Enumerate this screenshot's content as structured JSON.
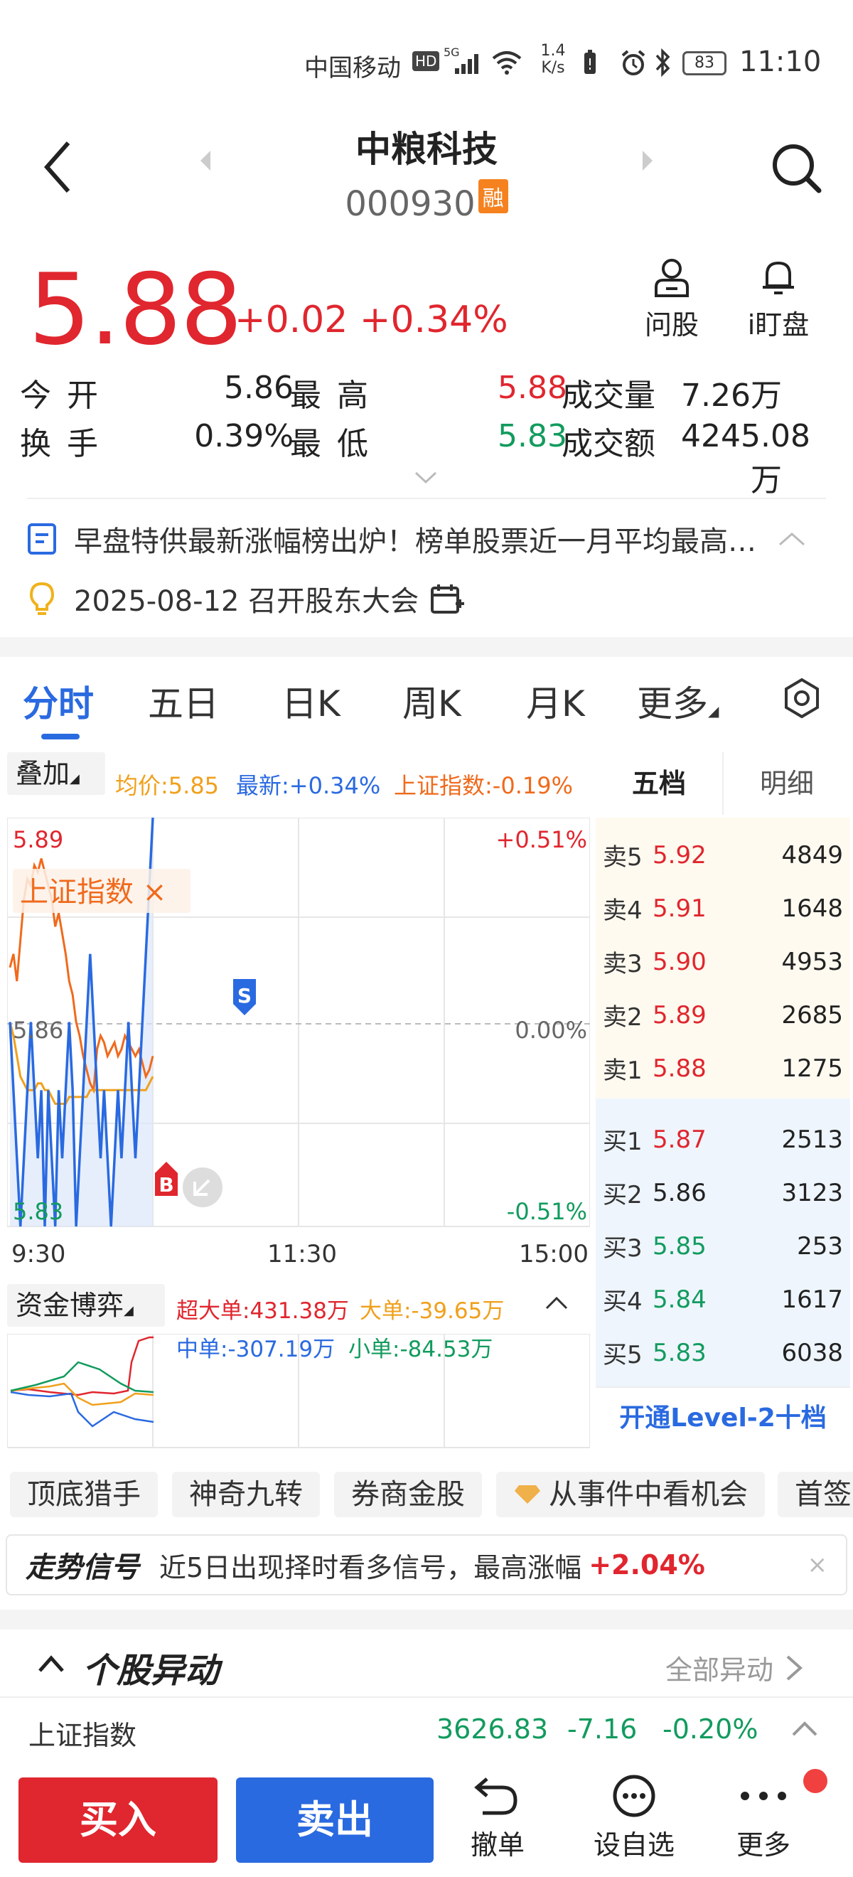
{
  "status_bar": {
    "carrier": "中国移动",
    "hd": "HD",
    "signal": "5G",
    "net_speed_value": "1.4",
    "net_speed_unit": "K/s",
    "battery": "83",
    "time": "11:10"
  },
  "header": {
    "title": "中粮科技",
    "code": "000930",
    "badge": "融"
  },
  "price": {
    "last": "5.88",
    "change": "+0.02",
    "change_pct": "+0.34%"
  },
  "actions": {
    "ask": "问股",
    "watch": "i盯盘"
  },
  "quote": {
    "open_label": "今开",
    "open": "5.86",
    "high_label": "最高",
    "high": "5.88",
    "vol_label": "成交量",
    "vol": "7.26万",
    "turn_label": "换手",
    "turn": "0.39%",
    "low_label": "最低",
    "low": "5.83",
    "amt_label": "成交额",
    "amt": "4245.08万"
  },
  "news": {
    "headline": "早盘特供最新涨幅榜出炉！榜单股票近一月平均最高…",
    "event": "2025-08-12 召开股东大会"
  },
  "tabs": [
    "分时",
    "五日",
    "日K",
    "周K",
    "月K",
    "更多"
  ],
  "overlay": {
    "label": "叠加",
    "avg": "均价:5.85",
    "latest": "最新:+0.34%",
    "index": "上证指数:-0.19%",
    "tag": "上证指数 ×"
  },
  "chart_labels": {
    "ymax": "5.89",
    "ymid": "5.86",
    "ymin": "5.83",
    "pmax": "+0.51%",
    "pmid": "0.00%",
    "pmin": "-0.51%",
    "t0": "9:30",
    "t1": "11:30",
    "t2": "15:00",
    "s": "S",
    "b": "B"
  },
  "chart_data": {
    "type": "line",
    "ylim": [
      5.83,
      5.89
    ],
    "x_ticks": [
      "9:30",
      "11:30",
      "15:00"
    ],
    "series": [
      {
        "values": [
          5.86,
          5.85,
          5.84,
          5.83,
          5.84,
          5.85,
          5.86,
          5.85,
          5.84,
          5.85,
          5.83,
          5.85,
          5.84,
          5.83,
          5.85,
          5.84,
          5.85,
          5.86,
          5.85,
          5.83,
          5.84,
          5.85,
          5.86,
          5.87,
          5.86,
          5.85,
          5.84,
          5.85,
          5.84,
          5.83,
          5.84,
          5.85,
          5.84,
          5.85,
          5.86,
          5.85,
          5.84,
          5.85,
          5.86,
          5.87,
          5.88,
          5.89
        ]
      },
      {
        "values": [
          5.86,
          5.858,
          5.855,
          5.852,
          5.851,
          5.85,
          5.85,
          5.85,
          5.851,
          5.851,
          5.85,
          5.85,
          5.849,
          5.848,
          5.848,
          5.848,
          5.848,
          5.849,
          5.849,
          5.849,
          5.849,
          5.849,
          5.849,
          5.85,
          5.85,
          5.85,
          5.85,
          5.85,
          5.85,
          5.85,
          5.85,
          5.85,
          5.85,
          5.85,
          5.85,
          5.85,
          5.85,
          5.85,
          5.85,
          5.85,
          5.851,
          5.852
        ]
      },
      {
        "name": "上证指数",
        "values": [
          5.868,
          5.87,
          5.866,
          5.872,
          5.878,
          5.881,
          5.88,
          5.883,
          5.882,
          5.884,
          5.882,
          5.88,
          5.878,
          5.874,
          5.876,
          5.873,
          5.87,
          5.866,
          5.864,
          5.86,
          5.858,
          5.855,
          5.853,
          5.851,
          5.85,
          5.856,
          5.858,
          5.857,
          5.855,
          5.856,
          5.857,
          5.855,
          5.856,
          5.858,
          5.857,
          5.856,
          5.855,
          5.856,
          5.854,
          5.852,
          5.853,
          5.855
        ]
      }
    ]
  },
  "orderbook": {
    "tabs": [
      "五档",
      "明细"
    ],
    "asks": [
      {
        "label": "卖5",
        "price": "5.92",
        "vol": "4849"
      },
      {
        "label": "卖4",
        "price": "5.91",
        "vol": "1648"
      },
      {
        "label": "卖3",
        "price": "5.90",
        "vol": "4953"
      },
      {
        "label": "卖2",
        "price": "5.89",
        "vol": "2685"
      },
      {
        "label": "卖1",
        "price": "5.88",
        "vol": "1275"
      }
    ],
    "bids": [
      {
        "label": "买1",
        "price": "5.87",
        "vol": "2513"
      },
      {
        "label": "买2",
        "price": "5.86",
        "vol": "3123"
      },
      {
        "label": "买3",
        "price": "5.85",
        "vol": "253"
      },
      {
        "label": "买4",
        "price": "5.84",
        "vol": "1617"
      },
      {
        "label": "买5",
        "price": "5.83",
        "vol": "6038"
      }
    ],
    "level2": "开通Level-2十档"
  },
  "fund": {
    "label": "资金博弈",
    "super": "超大单:431.38万",
    "big": "大单:-39.65万",
    "mid": "中单:-307.19万",
    "small": "小单:-84.53万"
  },
  "chips": [
    "顶底猎手",
    "神奇九转",
    "券商金股",
    "从事件中看机会",
    "首签"
  ],
  "signal": {
    "title": "走势信号",
    "text": "近5日出现择时看多信号，最高涨幅",
    "value": "+2.04%"
  },
  "movement": {
    "title": "个股异动",
    "all": "全部异动"
  },
  "index_bar": {
    "name": "上证指数",
    "value": "3626.83",
    "change": "-7.16",
    "pct": "-0.20%"
  },
  "bottom": {
    "buy": "买入",
    "sell": "卖出",
    "cancel": "撤单",
    "watchlist": "设自选",
    "more": "更多"
  }
}
